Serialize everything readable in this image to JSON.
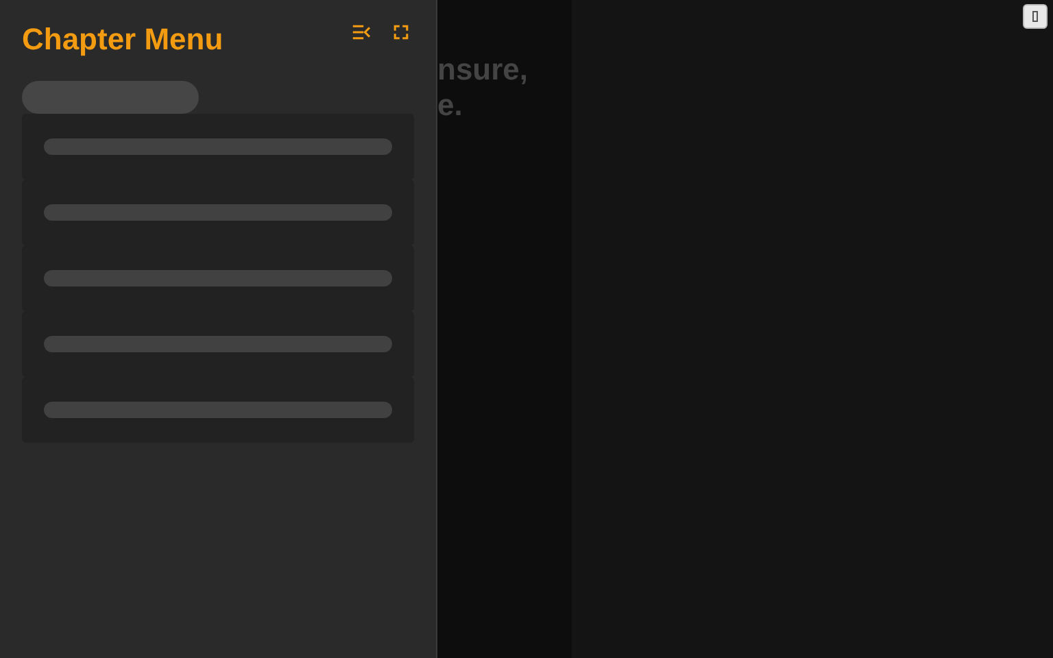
{
  "sidebar": {
    "title": "Chapter Menu",
    "placeholder_items": [
      {
        "kind": "pill"
      },
      {
        "kind": "card"
      },
      {
        "kind": "card"
      },
      {
        "kind": "card"
      },
      {
        "kind": "card"
      },
      {
        "kind": "card"
      }
    ]
  },
  "content": {
    "lines": [
      "nsure,",
      "e."
    ]
  }
}
